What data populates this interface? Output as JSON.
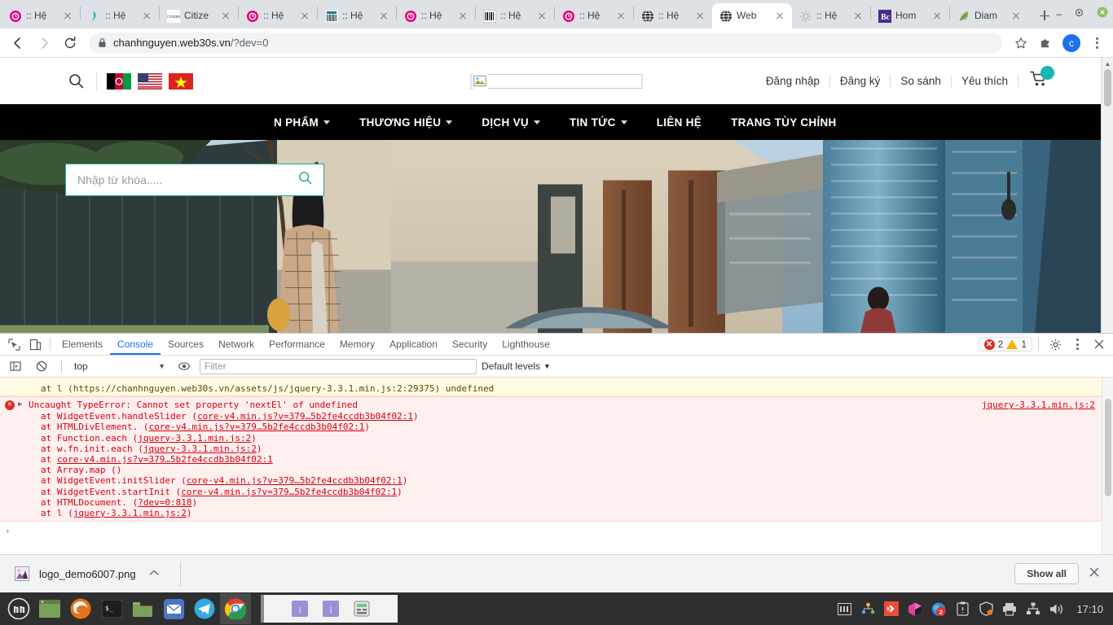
{
  "browser": {
    "tabs": [
      {
        "title": ":: Hệ",
        "favicon": "clock-pink-icon",
        "active": false
      },
      {
        "title": ":: Hệ",
        "favicon": "teal-hook-icon",
        "active": false
      },
      {
        "title": "Citize",
        "favicon": "citizen-icon",
        "active": false
      },
      {
        "title": ":: Hệ",
        "favicon": "clock-pink-icon",
        "active": false
      },
      {
        "title": ":: Hệ",
        "favicon": "frax-icon",
        "active": false
      },
      {
        "title": ":: Hệ",
        "favicon": "clock-pink-icon",
        "active": false
      },
      {
        "title": ":: Hệ",
        "favicon": "barcode-icon",
        "active": false
      },
      {
        "title": ":: Hệ",
        "favicon": "clock-pink-icon",
        "active": false
      },
      {
        "title": ":: Hệ",
        "favicon": "globe-dark-icon",
        "active": false
      },
      {
        "title": "Web",
        "favicon": "globe-dark-icon",
        "active": true
      },
      {
        "title": ":: Hệ",
        "favicon": "gear-grey-icon",
        "active": false
      },
      {
        "title": "Hom",
        "favicon": "bc-purple-icon",
        "active": false
      },
      {
        "title": "Diam",
        "favicon": "leaf-icon",
        "active": false
      }
    ],
    "new_tab_label": "+",
    "window_controls": {
      "minimize": "–",
      "maximize": "⧉",
      "close": "✕"
    },
    "address": {
      "host": "chanhnguyen.web30s.vn",
      "path": "/?dev=0",
      "lock_icon": "lock-icon"
    },
    "toolbar_icons": [
      "back-arrow-icon",
      "forward-arrow-icon",
      "reload-icon",
      "star-icon",
      "extensions-icon",
      "profile-avatar",
      "menu-kebab-icon"
    ],
    "profile_initial": "c"
  },
  "site": {
    "search_icon": "search-icon",
    "languages": [
      {
        "name": "afghanistan-flag",
        "code": "AF"
      },
      {
        "name": "usa-flag",
        "code": "US"
      },
      {
        "name": "vietnam-flag",
        "code": "VN"
      }
    ],
    "logo_placeholder": "broken-image-icon",
    "top_links": [
      "Đăng nhập",
      "Đăng ký",
      "So sánh",
      "Yêu thích"
    ],
    "cart_icon": "cart-icon",
    "search_panel": {
      "placeholder": "Nhập từ khóa.....",
      "value": "",
      "submit_icon": "search-icon"
    },
    "nav": [
      {
        "label": "N PHẨM",
        "has_dropdown": true
      },
      {
        "label": "THƯƠNG HIỆU",
        "has_dropdown": true
      },
      {
        "label": "DỊCH VỤ",
        "has_dropdown": true
      },
      {
        "label": "TIN TỨC",
        "has_dropdown": true
      },
      {
        "label": "LIÊN HỆ",
        "has_dropdown": false
      },
      {
        "label": "TRANG TÙY CHỈNH",
        "has_dropdown": false
      }
    ]
  },
  "devtools": {
    "left_icons": [
      "inspect-element-icon",
      "device-toolbar-icon"
    ],
    "tabs": [
      "Elements",
      "Console",
      "Sources",
      "Network",
      "Performance",
      "Memory",
      "Application",
      "Security",
      "Lighthouse"
    ],
    "active_tab": "Console",
    "error_count": "2",
    "warning_count": "1",
    "right_icons": [
      "settings-gear-icon",
      "more-kebab-icon",
      "close-devtools-icon"
    ],
    "filterbar": {
      "sidebar_icon": "console-sidebar-icon",
      "clear_icon": "clear-console-icon",
      "context": "top",
      "eye_icon": "live-expression-icon",
      "filter_placeholder": "Filter",
      "filter_value": "",
      "levels": "Default levels"
    },
    "console": {
      "warning_row": {
        "text": "at l (https://chanhnguyen.web30s.vn/assets/js/jquery-3.3.1.min.js:2:29375) undefined",
        "link": "https://chanhnguyen.web30s.vn/assets/js/jquery-3.3.1.min.js:2:29375",
        "suffix": "undefined"
      },
      "error": {
        "headline": "Uncaught TypeError: Cannot set property 'nextEl' of undefined",
        "source": "jquery-3.3.1.min.js:2",
        "stack": [
          {
            "fn": "at WidgetEvent.handleSlider (",
            "link": "core-v4.min.js?v=379…5b2fe4ccdb3b04f02:1",
            "close": ")"
          },
          {
            "fn": "at HTMLDivElement.<anonymous> (",
            "link": "core-v4.min.js?v=379…5b2fe4ccdb3b04f02:1",
            "close": ")"
          },
          {
            "fn": "at Function.each (",
            "link": "jquery-3.3.1.min.js:2",
            "close": ")"
          },
          {
            "fn": "at w.fn.init.each (",
            "link": "jquery-3.3.1.min.js:2",
            "close": ")"
          },
          {
            "fn": "at ",
            "link": "core-v4.min.js?v=379…5b2fe4ccdb3b04f02:1",
            "close": ""
          },
          {
            "fn": "at Array.map (<anonymous>)",
            "link": "",
            "close": ""
          },
          {
            "fn": "at WidgetEvent.initSlider (",
            "link": "core-v4.min.js?v=379…5b2fe4ccdb3b04f02:1",
            "close": ")"
          },
          {
            "fn": "at WidgetEvent.startInit (",
            "link": "core-v4.min.js?v=379…5b2fe4ccdb3b04f02:1",
            "close": ")"
          },
          {
            "fn": "at HTMLDocument.<anonymous> (",
            "link": "?dev=0:818",
            "close": ")"
          },
          {
            "fn": "at l (",
            "link": "jquery-3.3.1.min.js:2",
            "close": ")"
          }
        ]
      },
      "prompt_caret": "›"
    }
  },
  "download_shelf": {
    "file_name": "logo_demo6007.png",
    "file_icon": "image-thumb-icon",
    "menu_caret": "chevron-up-icon",
    "show_all_label": "Show all",
    "close_icon": "close-icon"
  },
  "taskbar": {
    "menu_icon": "linux-mint-menu-icon",
    "apps": [
      "window-list-icon",
      "firefox-icon",
      "terminal-icon",
      "files-icon",
      "mail-icon",
      "telegram-icon",
      "chrome-icon"
    ],
    "window_buttons": [
      "info-window-icon",
      "info-window-icon",
      "calc-window-icon"
    ],
    "tray": [
      "keyboard-layout-icon",
      "network-tree-icon",
      "anydesk-icon",
      "package-icon",
      "update-badge-icon",
      "clipboard-icon",
      "shield-icon",
      "printer-icon",
      "network-icon",
      "volume-icon"
    ],
    "update_count": "2",
    "clock": "17:10"
  },
  "colors": {
    "accent_teal": "#14b8ae",
    "devtools_blue": "#1a73e8",
    "error_red": "#d93025",
    "warning_yellow": "#f5b400",
    "nav_black": "#000000"
  }
}
